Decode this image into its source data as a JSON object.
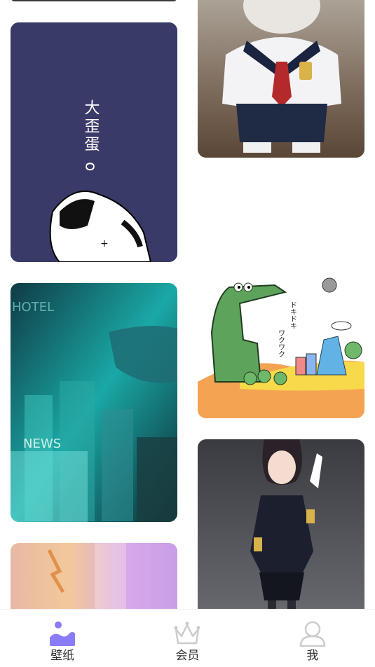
{
  "grid": {
    "items": [
      {
        "subject": "partial wallpaper (top-left)"
      },
      {
        "subject": "white cat in school uniform"
      },
      {
        "subject": "husky cartoon on navy background",
        "caption": "大歪蛋 o"
      },
      {
        "subject": "green crocodile cartoon",
        "caption": "ドキドキ ワクワク"
      },
      {
        "subject": "teal cyberpunk city with whale",
        "signs": [
          "HOTEL",
          "NEWS"
        ]
      },
      {
        "subject": "anime girl in navy uniform"
      },
      {
        "subject": "pastel pink/purple abstract"
      }
    ]
  },
  "tabbar": {
    "tabs": [
      {
        "label": "壁纸",
        "icon": "wallpaper-icon",
        "active": true
      },
      {
        "label": "会员",
        "icon": "crown-icon",
        "active": false
      },
      {
        "label": "我",
        "icon": "user-icon",
        "active": false
      }
    ],
    "active_color": "#8a7cf8",
    "inactive_color": "#cccccc"
  }
}
